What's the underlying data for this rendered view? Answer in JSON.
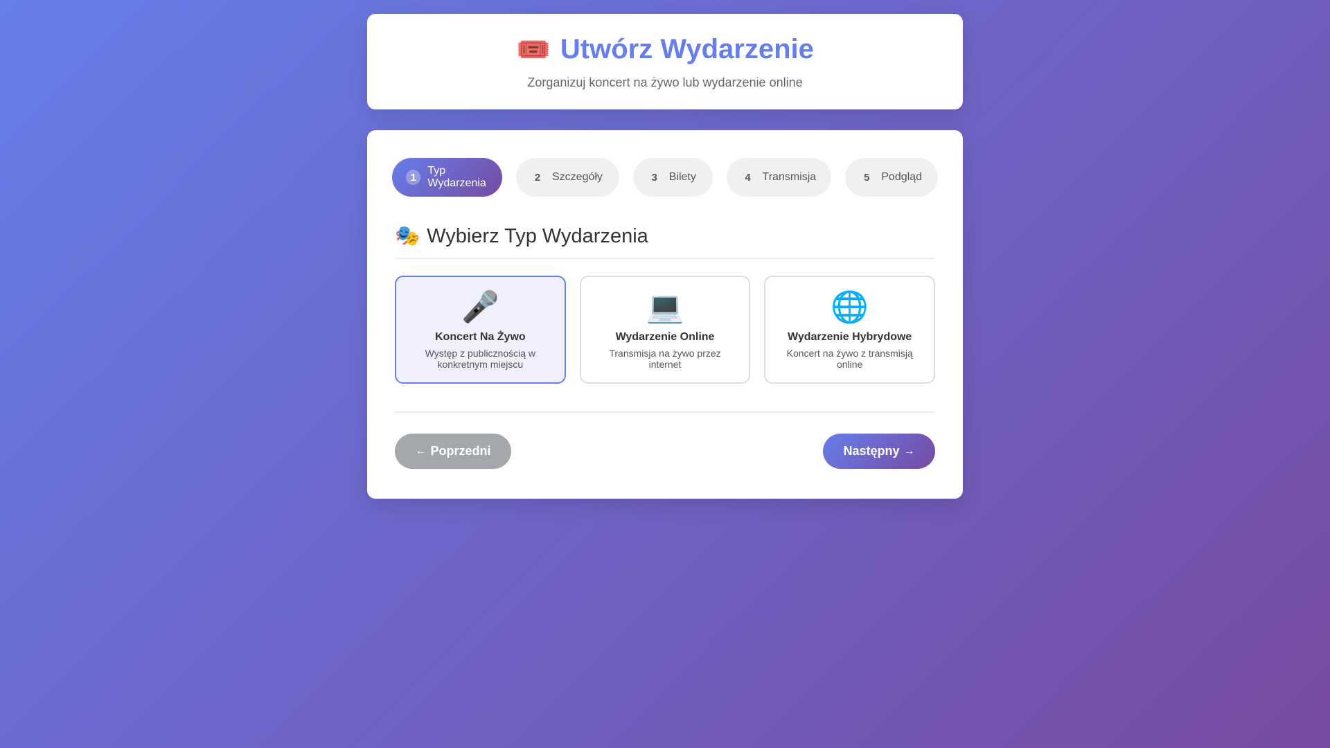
{
  "header": {
    "icon": "ticket-icon",
    "icon_glyph": "🎟️",
    "title": "Utwórz Wydarzenie",
    "subtitle": "Zorganizuj koncert na żywo lub wydarzenie online"
  },
  "steps": [
    {
      "num": "1",
      "label": "Typ Wydarzenia",
      "active": true
    },
    {
      "num": "2",
      "label": "Szczegóły",
      "active": false
    },
    {
      "num": "3",
      "label": "Bilety",
      "active": false
    },
    {
      "num": "4",
      "label": "Transmisja",
      "active": false
    },
    {
      "num": "5",
      "label": "Podgląd",
      "active": false
    }
  ],
  "section": {
    "icon": "theater-masks-icon",
    "icon_glyph": "🎭",
    "title": "Wybierz Typ Wydarzenia"
  },
  "options": [
    {
      "icon": "microphone-icon",
      "glyph": "🎤",
      "title": "Koncert Na Żywo",
      "desc": "Występ z publicznością w konkretnym miejscu",
      "selected": true
    },
    {
      "icon": "laptop-icon",
      "glyph": "💻",
      "title": "Wydarzenie Online",
      "desc": "Transmisja na żywo przez internet",
      "selected": false
    },
    {
      "icon": "globe-icon",
      "glyph": "🌐",
      "title": "Wydarzenie Hybrydowe",
      "desc": "Koncert na żywo z transmisją online",
      "selected": false
    }
  ],
  "nav": {
    "prev_label": "Poprzedni",
    "prev_arrow": "←",
    "next_label": "Następny",
    "next_arrow": "→"
  },
  "colors": {
    "accent": "#667eea",
    "accent_end": "#764ba2",
    "prev_button": "#a4a8ad"
  }
}
